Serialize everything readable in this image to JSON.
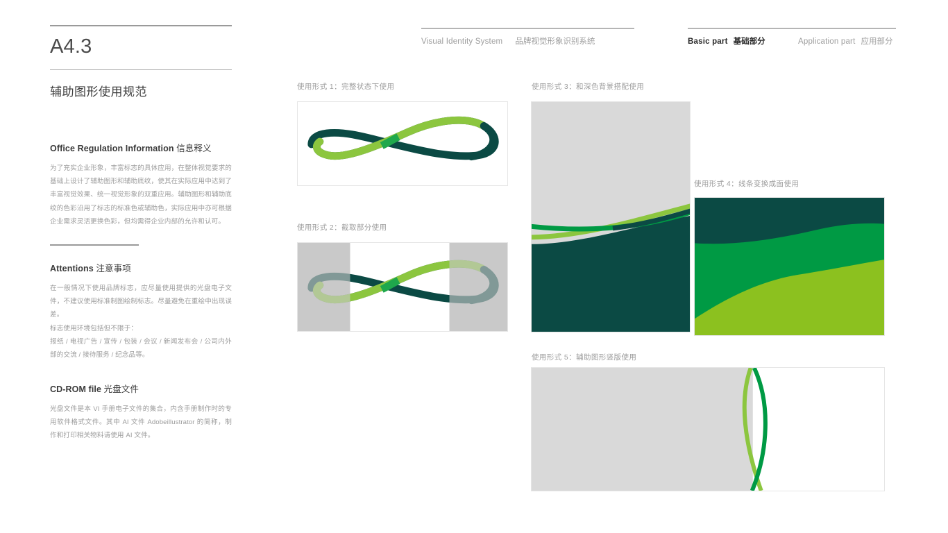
{
  "page": {
    "code": "A4.3",
    "title": "辅助图形使用规范"
  },
  "header": {
    "left": {
      "en": "Visual Identity System",
      "cn": "品牌视觉形象识别系统"
    },
    "right": {
      "basic": {
        "en": "Basic part",
        "cn": "基础部分"
      },
      "application": {
        "en": "Application part",
        "cn": "应用部分"
      }
    }
  },
  "sections": [
    {
      "id": "office-regulation",
      "head_en": "Office Regulation Information",
      "head_cn": "信息释义",
      "body": "为了充实企业形象，丰富标志的具体应用，在整体视觉要求的基础上设计了辅助图形和辅助底纹，使其在实际应用中达到了丰富视觉效果、统一视觉形象的双重应用。辅助图形和辅助底纹的色彩沿用了标志的标准色或辅助色，实际应用中亦可根据企业需求灵活更换色彩，但均需得企业内部的允许和认可。"
    },
    {
      "id": "attentions",
      "head_en": "Attentions",
      "head_cn": "注意事项",
      "body": "在一般情况下使用品牌标志，应尽量使用提供的光盘电子文件，不建议使用标准制图绘制标志。尽量避免在重绘中出现误差。\n标志使用环境包括但不限于：\n报纸 / 电视广告 / 宣传 / 包装 / 会议 / 新闻发布会 / 公司内外部的交流 / 接待服务 / 纪念品等。"
    },
    {
      "id": "cd-rom-file",
      "head_en": "CD-ROM file",
      "head_cn": "光盘文件",
      "body": "光盘文件是本 VI 手册电子文件的集合，内含手册制作时的专用软件格式文件。其中 AI 文件 Adobeillustrator 的简称，制作和打印相关物料请使用 AI 文件。"
    }
  ],
  "panels": [
    {
      "id": "usage-1",
      "caption": "使用形式 1：完整状态下使用"
    },
    {
      "id": "usage-2",
      "caption": "使用形式 2：截取部分使用"
    },
    {
      "id": "usage-3",
      "caption": "使用形式 3：和深色背景搭配使用"
    },
    {
      "id": "usage-4",
      "caption": "使用形式 4：线条变换成面使用"
    },
    {
      "id": "usage-5",
      "caption": "使用形式 5：辅助图形竖版使用"
    }
  ],
  "colors": {
    "light_green": "#8CC63F",
    "mid_green": "#009A44",
    "dark_teal": "#0B4A44",
    "cross_green": "#1FA84C",
    "gray_block": "#D9D9D9",
    "gray_band": "#C9C9C9",
    "rule_gray": "#9A9A9A",
    "text_gray": "#9C9C9C",
    "text_dark": "#3A3A3A"
  }
}
